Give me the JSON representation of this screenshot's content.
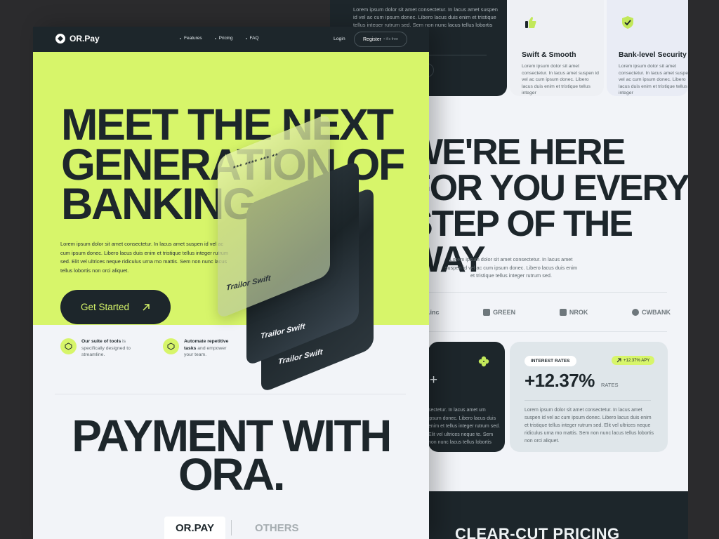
{
  "colors": {
    "lime": "#d7f56a",
    "dark": "#1d262b",
    "light": "#f2f4f8"
  },
  "right_page": {
    "dark_card_text": "Lorem ipsum dolor sit amet consectetur. In lacus amet suspen id vel ac cum ipsum donec. Libero lacus duis enim et tristique tellus integer rutrum sed. Sem non nunc lacus tellus lobortis",
    "features": [
      {
        "icon": "thumbs-up-icon",
        "title": "Swift & Smooth",
        "text": "Lorem ipsum dolor sit amet consectetur. In lacus amet suspen id vel ac cum ipsum donec. Libero lacus duis enim et tristique tellus integer"
      },
      {
        "icon": "shield-check-icon",
        "title": "Bank-level Security",
        "text": "Lorem ipsum dolor sit amet consectetur. In lacus amet suspen id vel ac cum ipsum donec. Libero lacus duis enim et tristique tellus integer"
      }
    ],
    "heading": "WE'RE HERE FOR YOU EVERY STEP OF THE WAY",
    "paragraph": "Lorem ipsum dolor sit amet consectetur. In lacus amet suspen id vel ac cum ipsum donec. Libero lacus duis enim et tristique tellus integer rutrum sed.",
    "logos": [
      ".inc",
      "GREEN",
      "NROK",
      "CWBANK"
    ],
    "dark_card2": {
      "plus": "+",
      "text": "sectetur. In lacus amet um ipsum donec. Libero lacus duis enim et tellus integer rutrum sed. Elit vel ultrices neque te. Sem non nunc lacus tellus lobortis"
    },
    "rates": {
      "pill": "INTEREST RATES",
      "badge": "+12.37% APY",
      "value": "+12.37%",
      "unit": "RATES",
      "text": "Lorem ipsum dolor sit amet consectetur. In lacus amet suspen id vel ac cum ipsum donec. Libero lacus duis enim et tristique tellus integer rutrum sed. Elit vel ultrices neque ridiculus urna mo mattis. Sem non nunc lacus tellus lobortis non orci aliquet."
    },
    "footer_title": "CLEAR-CUT PRICING"
  },
  "left_page": {
    "nav": {
      "logo": "OR.Pay",
      "links": [
        "Features",
        "Pricing",
        "FAQ"
      ],
      "login": "Login",
      "register": "Register",
      "register_sub": "• it's free"
    },
    "hero": {
      "heading": "MEET THE NEXT GENERATION OF BANKING",
      "paragraph": "Lorem ipsum dolor sit amet consectetur. In lacus amet suspen id vel ac cum ipsum donec. Libero lacus duis enim et tristique tellus integer rutrum sed. Elit vel ultrices neque ridiculus urna mo mattis. Sem non nunc lacus tellus lobortis non orci aliquet.",
      "cta": "Get Started"
    },
    "cards": {
      "number": "*** **** ***  **",
      "names": [
        "Trailor Swift",
        "Trailor Swift",
        "Trailor Swift"
      ]
    },
    "features": [
      {
        "bold": "Our suite of tools",
        "rest": " is specifically designed to streamline."
      },
      {
        "bold": "Automate repetitive tasks",
        "rest": " and empower your team."
      }
    ],
    "payment_heading": "PAYMENT WITH ORA.",
    "tabs": [
      "OR.PAY",
      "OTHERS"
    ]
  }
}
